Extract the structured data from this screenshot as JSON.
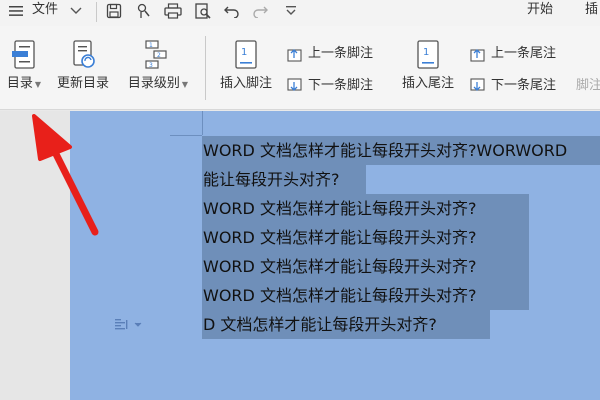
{
  "titlebar": {
    "file_label": "文件",
    "tabs": [
      {
        "label": "开始"
      },
      {
        "label": "插"
      }
    ]
  },
  "ribbon": {
    "toc": {
      "label": "目录"
    },
    "update_toc": {
      "label": "更新目录"
    },
    "toc_level": {
      "label": "目录级别"
    },
    "insert_footnote": {
      "label": "插入脚注"
    },
    "prev_footnote": {
      "label": "上一条脚注"
    },
    "next_footnote": {
      "label": "下一条脚注"
    },
    "insert_endnote": {
      "label": "插入尾注"
    },
    "prev_endnote": {
      "label": "上一条尾注"
    },
    "next_endnote": {
      "label": "下一条尾注"
    },
    "footnote_cut": {
      "label": "脚注"
    }
  },
  "document": {
    "lines": [
      "WORD 文档怎样才能让每段开头对齐?WORWORD",
      "能让每段开头对齐?",
      "WORD 文档怎样才能让每段开头对齐?",
      "WORD 文档怎样才能让每段开头对齐?",
      "WORD 文档怎样才能让每段开头对齐?",
      "WORD 文档怎样才能让每段开头对齐?",
      "D 文档怎样才能让每段开头对齐?"
    ]
  },
  "colors": {
    "page_background": "#8fb2e3",
    "selection": "#6f8fb9",
    "arrow": "#e8201a"
  }
}
